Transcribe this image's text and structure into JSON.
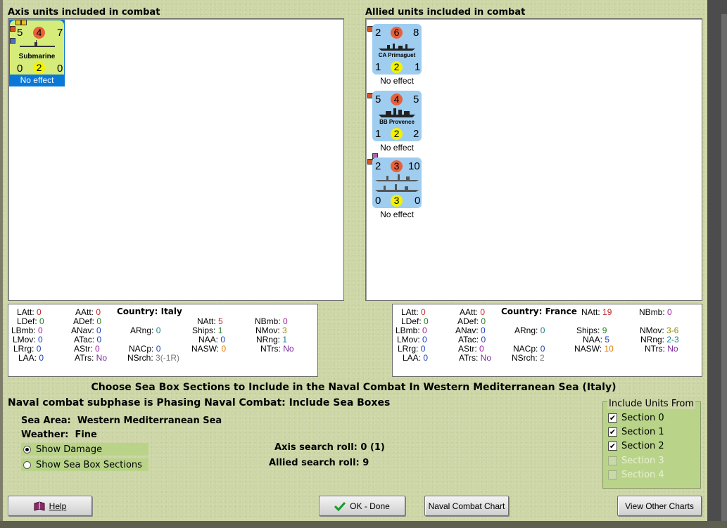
{
  "axis_panel": {
    "title": "Axis units included in combat",
    "units": [
      {
        "top_left": "5",
        "top_mid": "4",
        "top_right": "7",
        "name": "Submarine",
        "bottom_left": "0",
        "bottom_mid": "2",
        "bottom_right": "0",
        "effect": "No effect"
      }
    ]
  },
  "allied_panel": {
    "title": "Allied units included in combat",
    "units": [
      {
        "top_left": "2",
        "top_mid": "6",
        "top_right": "8",
        "name": "CA Primaguet",
        "bottom_left": "1",
        "bottom_mid": "2",
        "bottom_right": "1",
        "effect": "No effect"
      },
      {
        "top_left": "5",
        "top_mid": "4",
        "top_right": "5",
        "name": "BB Provence",
        "bottom_left": "1",
        "bottom_mid": "2",
        "bottom_right": "2",
        "effect": "No effect"
      },
      {
        "top_left": "2",
        "top_mid": "3",
        "top_right": "10",
        "name": "",
        "bottom_left": "0",
        "bottom_mid": "3",
        "bottom_right": "0",
        "effect": "No effect"
      }
    ]
  },
  "axis_stats": {
    "country_label": "Country:",
    "country": "Italy",
    "LAtt": "0",
    "LDef": "0",
    "LBmb": "0",
    "LMov": "0",
    "LRrg": "0",
    "LAA": "0",
    "AAtt": "0",
    "ADef": "0",
    "ANav": "0",
    "ATac": "0",
    "AStr": "0",
    "ATrs": "No",
    "ARng": "0",
    "NACp": "0",
    "NSrch": "3(-1R)",
    "NAtt": "5",
    "Ships": "1",
    "NAA": "0",
    "NASW": "0",
    "NBmb": "0",
    "NMov": "3",
    "NRng": "1",
    "NTrs": "No"
  },
  "allied_stats": {
    "country_label": "Country:",
    "country": "France",
    "LAtt": "0",
    "LDef": "0",
    "LBmb": "0",
    "LMov": "0",
    "LRrg": "0",
    "LAA": "0",
    "AAtt": "0",
    "ADef": "0",
    "ANav": "0",
    "ATac": "0",
    "AStr": "0",
    "ATrs": "No",
    "ARng": "0",
    "NACp": "0",
    "NSrch": "2",
    "NAtt": "19",
    "Ships": "9",
    "NAA": "5",
    "NASW": "10",
    "NBmb": "0",
    "NMov": "3-6",
    "NRng": "2-3",
    "NTrs": "No"
  },
  "labels": {
    "LAtt": "LAtt:",
    "LDef": "LDef:",
    "LBmb": "LBmb:",
    "LMov": "LMov:",
    "LRrg": "LRrg:",
    "LAA": "LAA:",
    "AAtt": "AAtt:",
    "ADef": "ADef:",
    "ANav": "ANav:",
    "ATac": "ATac:",
    "AStr": "AStr:",
    "ATrs": "ATrs:",
    "ARng": "ARng:",
    "NACp": "NACp:",
    "NSrch": "NSrch:",
    "NAtt": "NAtt:",
    "Ships": "Ships:",
    "NAA": "NAA:",
    "NASW": "NASW:",
    "NBmb": "NBmb:",
    "NMov": "NMov:",
    "NRng": "NRng:",
    "NTrs": "NTrs:"
  },
  "heading": "Choose Sea Box Sections to Include in the Naval Combat In Western Mediterranean Sea (Italy)",
  "subphase": "Naval combat subphase is Phasing Naval Combat: Include Sea Boxes",
  "info": {
    "sea_area_label": "Sea Area:",
    "sea_area": "Western Mediterranean Sea",
    "weather_label": "Weather:",
    "weather": "Fine",
    "axis_search": "Axis search roll: 0 (1)",
    "allied_search": "Allied search roll: 9"
  },
  "view_options": {
    "show_damage": "Show Damage",
    "show_sea_box_sections": "Show Sea Box Sections",
    "selected": "Show Damage"
  },
  "include_units": {
    "title": "Include Units From",
    "sections": [
      {
        "label": "Section 0",
        "checked": true,
        "enabled": true
      },
      {
        "label": "Section 1",
        "checked": true,
        "enabled": true
      },
      {
        "label": "Section 2",
        "checked": true,
        "enabled": true
      },
      {
        "label": "Section 3",
        "checked": false,
        "enabled": false
      },
      {
        "label": "Section 4",
        "checked": false,
        "enabled": false
      }
    ]
  },
  "buttons": {
    "help": "Help",
    "ok": "OK - Done",
    "naval_chart": "Naval Combat Chart",
    "view_other": "View Other Charts"
  },
  "colors": {
    "background": "#cdd6a6",
    "axis_counter": "#d6ec7a",
    "allied_counter": "#9fcdf0",
    "selection": "#0a78d7",
    "options_panel": "#b9d489"
  }
}
